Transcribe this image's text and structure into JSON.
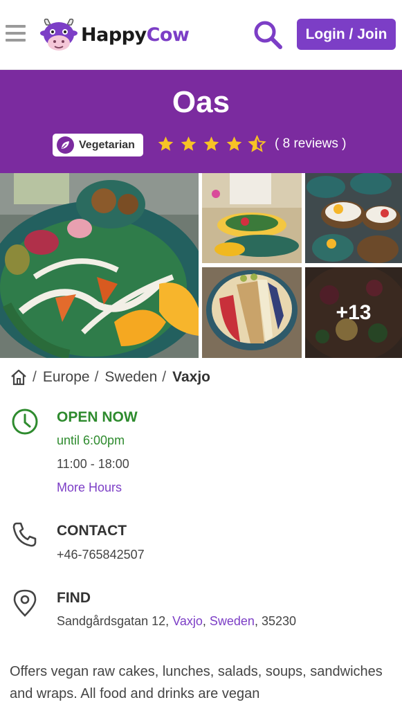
{
  "header": {
    "logo": {
      "word1": "Happy",
      "word2": "Cow"
    },
    "login_label": "Login / Join"
  },
  "listing": {
    "name": "Oas",
    "type_badge": "Vegetarian",
    "rating": 4.5,
    "reviews_label": "( 8 reviews )"
  },
  "photos": {
    "more_label": "+13"
  },
  "breadcrumb": {
    "items": [
      "Europe",
      "Sweden"
    ],
    "current": "Vaxjo"
  },
  "hours": {
    "status": "OPEN NOW",
    "until": "until 6:00pm",
    "range": "11:00 - 18:00",
    "more_link": "More Hours"
  },
  "contact": {
    "heading": "CONTACT",
    "phone": "+46-765842507"
  },
  "find": {
    "heading": "FIND",
    "street": "Sandgårdsgatan 12,",
    "city": "Vaxjo",
    "country": "Sweden",
    "postcode": ", 35230"
  },
  "description": "Offers vegan raw cakes, lunches, salads, soups, sandwiches and wraps. All food and drinks are vegan",
  "colors": {
    "brand_purple": "#7c3ec6",
    "band_purple": "#7b2b9f",
    "open_green": "#2e8b2e",
    "star_yellow": "#f7c325"
  }
}
